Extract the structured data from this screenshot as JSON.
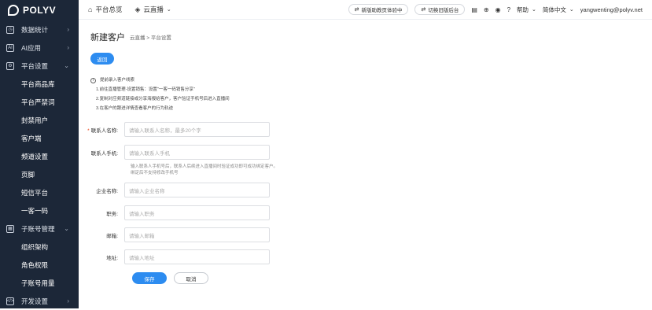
{
  "brand": {
    "name": "POLYV"
  },
  "sidebar": {
    "items": [
      {
        "label": "数据统计",
        "icon": "chart-icon",
        "type": "top",
        "arrow": "›"
      },
      {
        "label": "AI应用",
        "icon": "ai-icon",
        "type": "top",
        "arrow": "›"
      },
      {
        "label": "平台设置",
        "icon": "gear-icon",
        "type": "top",
        "arrow": "⌄"
      },
      {
        "label": "平台商品库",
        "type": "sub"
      },
      {
        "label": "平台严禁词",
        "type": "sub"
      },
      {
        "label": "封禁用户",
        "type": "sub"
      },
      {
        "label": "客户端",
        "type": "sub"
      },
      {
        "label": "频道设置",
        "type": "sub"
      },
      {
        "label": "页脚",
        "type": "sub"
      },
      {
        "label": "短信平台",
        "type": "sub"
      },
      {
        "label": "一客一码",
        "type": "sub"
      },
      {
        "label": "子账号管理",
        "icon": "account-icon",
        "type": "top",
        "arrow": "⌄"
      },
      {
        "label": "组织架构",
        "type": "sub"
      },
      {
        "label": "角色权限",
        "type": "sub"
      },
      {
        "label": "子账号用量",
        "type": "sub"
      },
      {
        "label": "开发设置",
        "icon": "code-icon",
        "type": "top",
        "arrow": "›"
      }
    ]
  },
  "topbar": {
    "home": "平台总览",
    "product": "云直播",
    "new_version_exp": "新版助教页体验中",
    "switch_old": "切换旧版后台",
    "help": "帮助",
    "language": "简体中文",
    "user": "yangwenting@polyv.net"
  },
  "page": {
    "title": "新建客户",
    "breadcrumb": "云直播 > 平台设置",
    "back_label": "返回",
    "tips": {
      "title": "提前录入客户线索",
      "lines": [
        "1.前往直播管理-设置销售：设置\"一客一码销售分享\"",
        "2.复制对应频道链接或分享海报给客户，客户验证手机号后进入直播间",
        "3.在客户的跟进详情查看客户的行为轨迹"
      ]
    },
    "form": {
      "contact_name": {
        "label": "联系人名称:",
        "placeholder": "请输入联系人名称，最多20个字",
        "required": "*"
      },
      "contact_phone": {
        "label": "联系人手机:",
        "placeholder": "请输入联系人手机"
      },
      "phone_hint": "输入联系人手机号后，联系人后续进入直播间时验证成功即可成功绑定客户。绑定后不支持修改手机号",
      "company": {
        "label": "企业名称:",
        "placeholder": "请输入企业名称"
      },
      "position": {
        "label": "职务:",
        "placeholder": "请输入职务"
      },
      "email": {
        "label": "邮箱:",
        "placeholder": "请输入邮箱"
      },
      "address": {
        "label": "地址:",
        "placeholder": "请输入地址"
      },
      "save_label": "保存",
      "cancel_label": "取消"
    }
  }
}
